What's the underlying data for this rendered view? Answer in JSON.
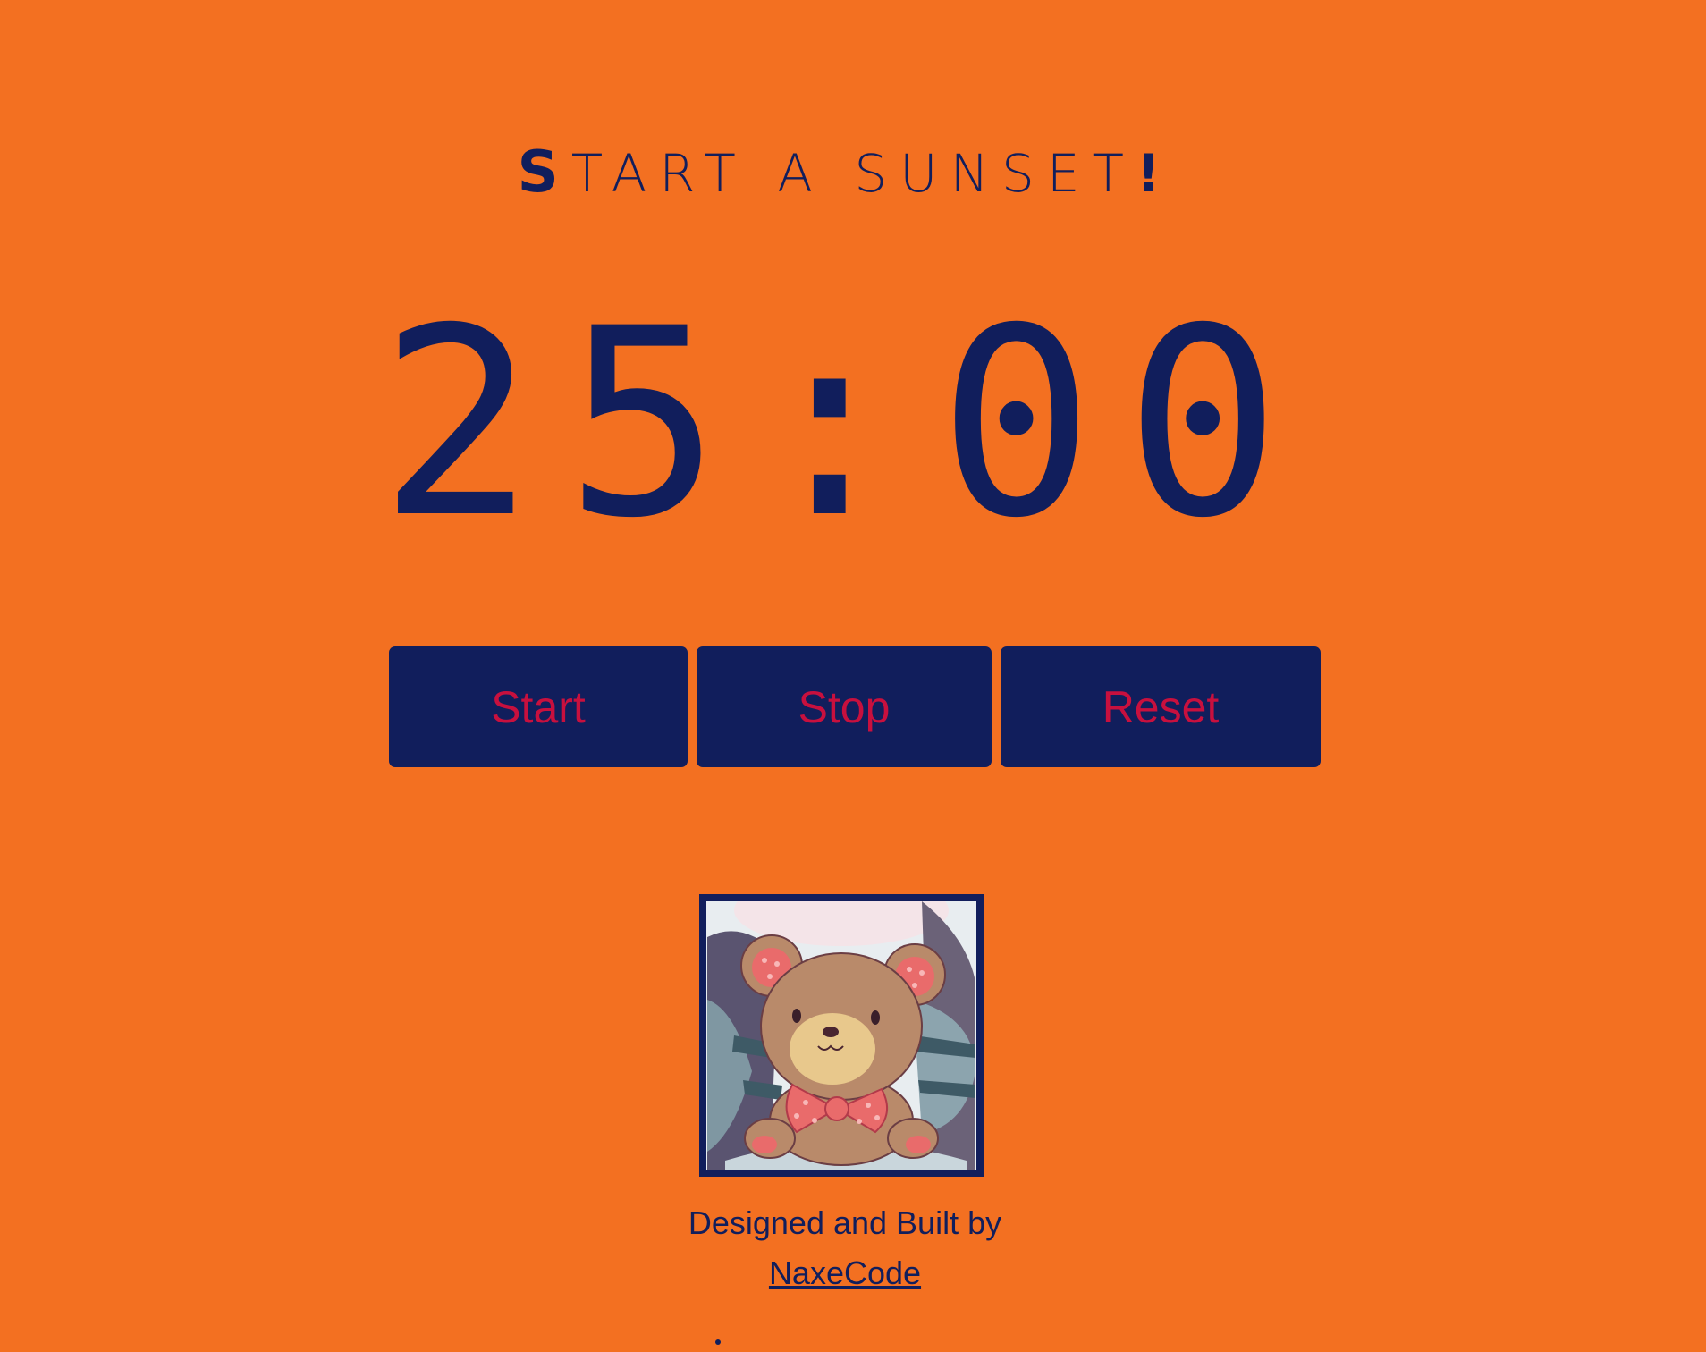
{
  "header": {
    "title_first": "S",
    "title_rest": "tart a Sunset",
    "title_bang": "!"
  },
  "timer": {
    "display": "25:00"
  },
  "controls": {
    "start_label": "Start",
    "stop_label": "Stop",
    "reset_label": "Reset"
  },
  "avatar": {
    "subject": "teddy-bear-avatar"
  },
  "footer": {
    "credit_text": "Designed and Built by",
    "author_link": "NaxeCode"
  },
  "colors": {
    "background": "#F37021",
    "primary": "#111E5C",
    "button_text": "#C8103E"
  }
}
